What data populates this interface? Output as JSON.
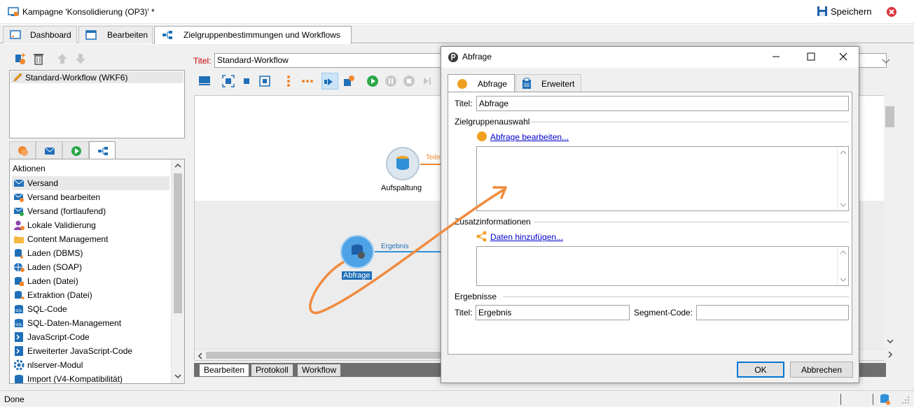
{
  "window": {
    "title": "Kampagne 'Konsolidierung (OP3)' *",
    "save_label": "Speichern"
  },
  "tabs": [
    {
      "label": "Dashboard",
      "icon": "dashboard-icon"
    },
    {
      "label": "Bearbeiten",
      "icon": "edit-icon"
    },
    {
      "label": "Zielgruppenbestimmungen und Workflows",
      "icon": "workflow-icon"
    }
  ],
  "left": {
    "workflow_item": "Standard-Workflow (WKF6)",
    "actions_header": "Aktionen",
    "actions": [
      "Versand",
      "Versand bearbeiten",
      "Versand (fortlaufend)",
      "Lokale Validierung",
      "Content Management",
      "Laden (DBMS)",
      "Laden (SOAP)",
      "Laden (Datei)",
      "Extraktion (Datei)",
      "SQL-Code",
      "SQL-Daten-Management",
      "JavaScript-Code",
      "Erweiterter JavaScript-Code",
      "nlserver-Modul",
      "Import (V4-Kompatibilität)"
    ]
  },
  "editor": {
    "title_label": "Titel:",
    "title_value": "Standard-Workflow",
    "nodes": {
      "split_label": "Aufspaltung",
      "split_link": "Teilm",
      "query_label": "Abfrage",
      "query_link": "Ergebnis"
    },
    "bottom_tabs": [
      "Bearbeiten",
      "Protokoll",
      "Workflow"
    ]
  },
  "status": {
    "text": "Done"
  },
  "dialog": {
    "title": "Abfrage",
    "tabs": [
      "Abfrage",
      "Erweitert"
    ],
    "titel_label": "Titel:",
    "titel_value": "Abfrage",
    "group_target": "Zielgruppenauswahl",
    "edit_query_link": "Abfrage bearbeiten...",
    "group_additional": "Zusatzinformationen",
    "add_data_link": "Daten hinzufügen...",
    "group_results": "Ergebnisse",
    "result_title_label": "Titel:",
    "result_title_value": "Ergebnis",
    "segment_label": "Segment-Code:",
    "segment_value": "",
    "ok_label": "OK",
    "cancel_label": "Abbrechen"
  },
  "colors": {
    "accent_orange": "#f0872e",
    "node_blue": "#2f8fd8",
    "link_blue": "#0000cc",
    "close_red": "#d9363e"
  }
}
